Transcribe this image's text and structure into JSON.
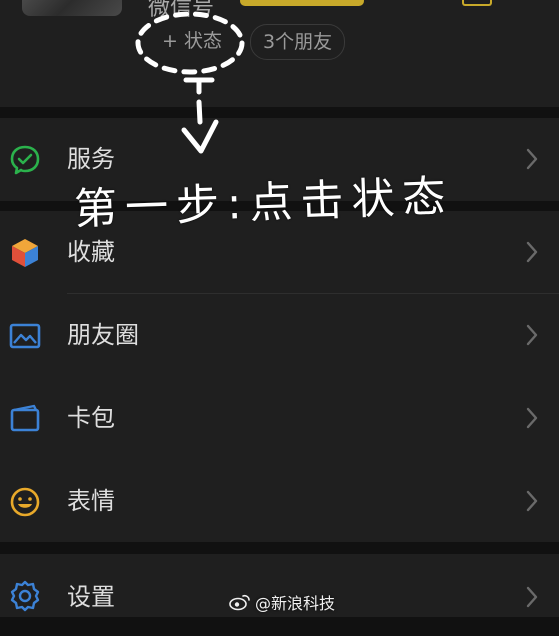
{
  "profile": {
    "wechat_id_label": "微信号",
    "status_button_label": "+ 状态",
    "friends_label": "3个朋友"
  },
  "menu": {
    "items": [
      {
        "label": "服务",
        "icon": "services-icon",
        "color": "#2bb24c"
      },
      {
        "label": "收藏",
        "icon": "favorites-icon",
        "color": "#f0a63a"
      },
      {
        "label": "朋友圈",
        "icon": "moments-icon",
        "color": "#3c82d6"
      },
      {
        "label": "卡包",
        "icon": "card-wallet-icon",
        "color": "#3c82d6"
      },
      {
        "label": "表情",
        "icon": "sticker-icon",
        "color": "#e8a92a"
      },
      {
        "label": "设置",
        "icon": "settings-icon",
        "color": "#3c82d6"
      }
    ]
  },
  "annotation": {
    "text": "第一步:点击状态"
  },
  "watermark": {
    "text": "@新浪科技"
  },
  "colors": {
    "background": "#111111",
    "card": "#1f1f1f",
    "label": "#dedede",
    "chevron": "#6a6a6a",
    "badge": "#c8a92a"
  }
}
